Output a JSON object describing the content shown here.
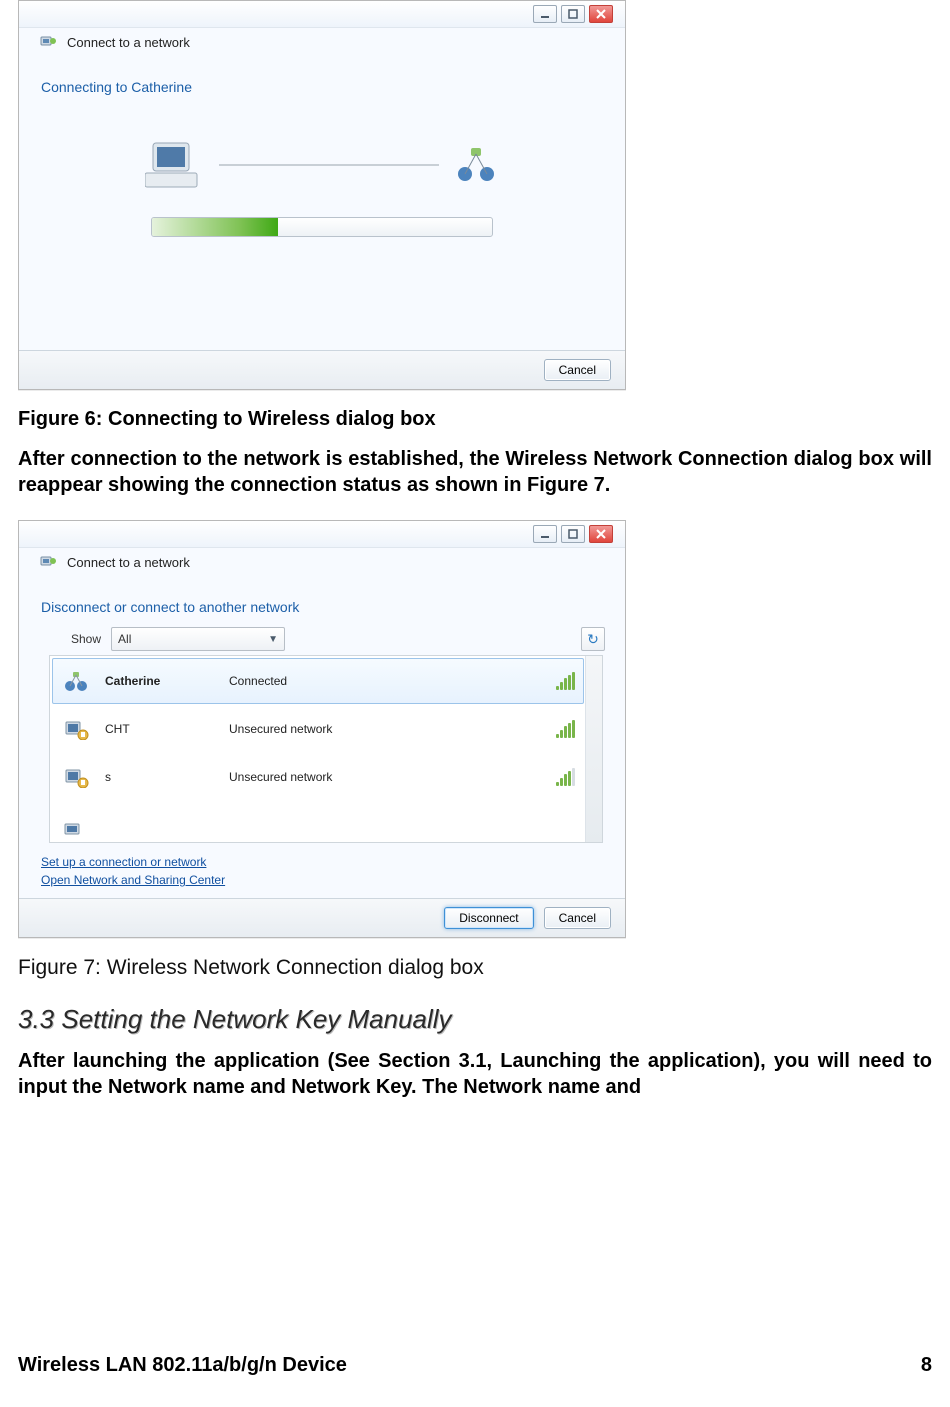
{
  "dialog1": {
    "title": "Connect to a network",
    "heading": "Connecting to Catherine",
    "cancel": "Cancel"
  },
  "fig6": "Figure 6: Connecting to Wireless dialog box",
  "para1": "After connection to the network is established, the Wireless Network Connection dialog box will reappear showing the connection status as shown in Figure 7.",
  "dialog2": {
    "title": "Connect to a network",
    "heading": "Disconnect or connect to another network",
    "show_label": "Show",
    "show_value": "All",
    "networks": [
      {
        "name": "Catherine",
        "status": "Connected",
        "signal": 5,
        "locked": false,
        "selected": true
      },
      {
        "name": "CHT",
        "status": "Unsecured network",
        "signal": 5,
        "locked": true,
        "selected": false
      },
      {
        "name": "s",
        "status": "Unsecured network",
        "signal": 4,
        "locked": true,
        "selected": false
      }
    ],
    "link1": "Set up a connection or network",
    "link2": "Open Network and Sharing Center",
    "disconnect": "Disconnect",
    "cancel": "Cancel"
  },
  "fig7": "Figure 7: Wireless Network Connection dialog box",
  "section": "3.3 Setting the Network Key Manually",
  "para2": "After launching the application (See Section 3.1, Launching the application), you will need to input the Network name and Network Key. The Network name and",
  "footer_left": "Wireless LAN 802.11a/b/g/n Device",
  "footer_right": "8"
}
